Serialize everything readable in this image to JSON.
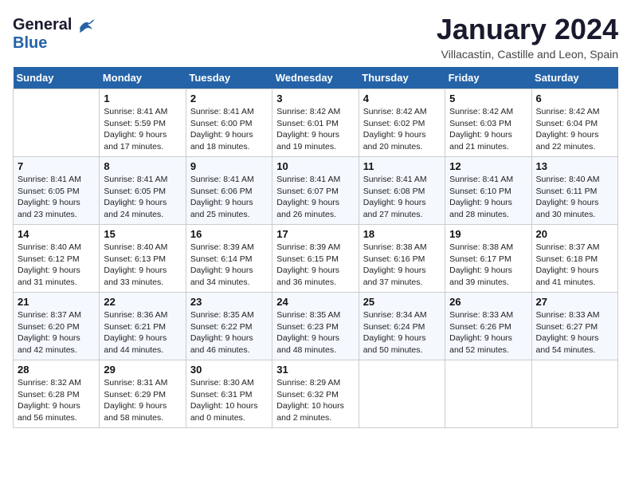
{
  "header": {
    "logo_line1": "General",
    "logo_line2": "Blue",
    "month": "January 2024",
    "location": "Villacastin, Castille and Leon, Spain"
  },
  "weekdays": [
    "Sunday",
    "Monday",
    "Tuesday",
    "Wednesday",
    "Thursday",
    "Friday",
    "Saturday"
  ],
  "weeks": [
    [
      {
        "day": "",
        "info": ""
      },
      {
        "day": "1",
        "info": "Sunrise: 8:41 AM\nSunset: 5:59 PM\nDaylight: 9 hours\nand 17 minutes."
      },
      {
        "day": "2",
        "info": "Sunrise: 8:41 AM\nSunset: 6:00 PM\nDaylight: 9 hours\nand 18 minutes."
      },
      {
        "day": "3",
        "info": "Sunrise: 8:42 AM\nSunset: 6:01 PM\nDaylight: 9 hours\nand 19 minutes."
      },
      {
        "day": "4",
        "info": "Sunrise: 8:42 AM\nSunset: 6:02 PM\nDaylight: 9 hours\nand 20 minutes."
      },
      {
        "day": "5",
        "info": "Sunrise: 8:42 AM\nSunset: 6:03 PM\nDaylight: 9 hours\nand 21 minutes."
      },
      {
        "day": "6",
        "info": "Sunrise: 8:42 AM\nSunset: 6:04 PM\nDaylight: 9 hours\nand 22 minutes."
      }
    ],
    [
      {
        "day": "7",
        "info": "Sunrise: 8:41 AM\nSunset: 6:05 PM\nDaylight: 9 hours\nand 23 minutes."
      },
      {
        "day": "8",
        "info": "Sunrise: 8:41 AM\nSunset: 6:05 PM\nDaylight: 9 hours\nand 24 minutes."
      },
      {
        "day": "9",
        "info": "Sunrise: 8:41 AM\nSunset: 6:06 PM\nDaylight: 9 hours\nand 25 minutes."
      },
      {
        "day": "10",
        "info": "Sunrise: 8:41 AM\nSunset: 6:07 PM\nDaylight: 9 hours\nand 26 minutes."
      },
      {
        "day": "11",
        "info": "Sunrise: 8:41 AM\nSunset: 6:08 PM\nDaylight: 9 hours\nand 27 minutes."
      },
      {
        "day": "12",
        "info": "Sunrise: 8:41 AM\nSunset: 6:10 PM\nDaylight: 9 hours\nand 28 minutes."
      },
      {
        "day": "13",
        "info": "Sunrise: 8:40 AM\nSunset: 6:11 PM\nDaylight: 9 hours\nand 30 minutes."
      }
    ],
    [
      {
        "day": "14",
        "info": "Sunrise: 8:40 AM\nSunset: 6:12 PM\nDaylight: 9 hours\nand 31 minutes."
      },
      {
        "day": "15",
        "info": "Sunrise: 8:40 AM\nSunset: 6:13 PM\nDaylight: 9 hours\nand 33 minutes."
      },
      {
        "day": "16",
        "info": "Sunrise: 8:39 AM\nSunset: 6:14 PM\nDaylight: 9 hours\nand 34 minutes."
      },
      {
        "day": "17",
        "info": "Sunrise: 8:39 AM\nSunset: 6:15 PM\nDaylight: 9 hours\nand 36 minutes."
      },
      {
        "day": "18",
        "info": "Sunrise: 8:38 AM\nSunset: 6:16 PM\nDaylight: 9 hours\nand 37 minutes."
      },
      {
        "day": "19",
        "info": "Sunrise: 8:38 AM\nSunset: 6:17 PM\nDaylight: 9 hours\nand 39 minutes."
      },
      {
        "day": "20",
        "info": "Sunrise: 8:37 AM\nSunset: 6:18 PM\nDaylight: 9 hours\nand 41 minutes."
      }
    ],
    [
      {
        "day": "21",
        "info": "Sunrise: 8:37 AM\nSunset: 6:20 PM\nDaylight: 9 hours\nand 42 minutes."
      },
      {
        "day": "22",
        "info": "Sunrise: 8:36 AM\nSunset: 6:21 PM\nDaylight: 9 hours\nand 44 minutes."
      },
      {
        "day": "23",
        "info": "Sunrise: 8:35 AM\nSunset: 6:22 PM\nDaylight: 9 hours\nand 46 minutes."
      },
      {
        "day": "24",
        "info": "Sunrise: 8:35 AM\nSunset: 6:23 PM\nDaylight: 9 hours\nand 48 minutes."
      },
      {
        "day": "25",
        "info": "Sunrise: 8:34 AM\nSunset: 6:24 PM\nDaylight: 9 hours\nand 50 minutes."
      },
      {
        "day": "26",
        "info": "Sunrise: 8:33 AM\nSunset: 6:26 PM\nDaylight: 9 hours\nand 52 minutes."
      },
      {
        "day": "27",
        "info": "Sunrise: 8:33 AM\nSunset: 6:27 PM\nDaylight: 9 hours\nand 54 minutes."
      }
    ],
    [
      {
        "day": "28",
        "info": "Sunrise: 8:32 AM\nSunset: 6:28 PM\nDaylight: 9 hours\nand 56 minutes."
      },
      {
        "day": "29",
        "info": "Sunrise: 8:31 AM\nSunset: 6:29 PM\nDaylight: 9 hours\nand 58 minutes."
      },
      {
        "day": "30",
        "info": "Sunrise: 8:30 AM\nSunset: 6:31 PM\nDaylight: 10 hours\nand 0 minutes."
      },
      {
        "day": "31",
        "info": "Sunrise: 8:29 AM\nSunset: 6:32 PM\nDaylight: 10 hours\nand 2 minutes."
      },
      {
        "day": "",
        "info": ""
      },
      {
        "day": "",
        "info": ""
      },
      {
        "day": "",
        "info": ""
      }
    ]
  ]
}
